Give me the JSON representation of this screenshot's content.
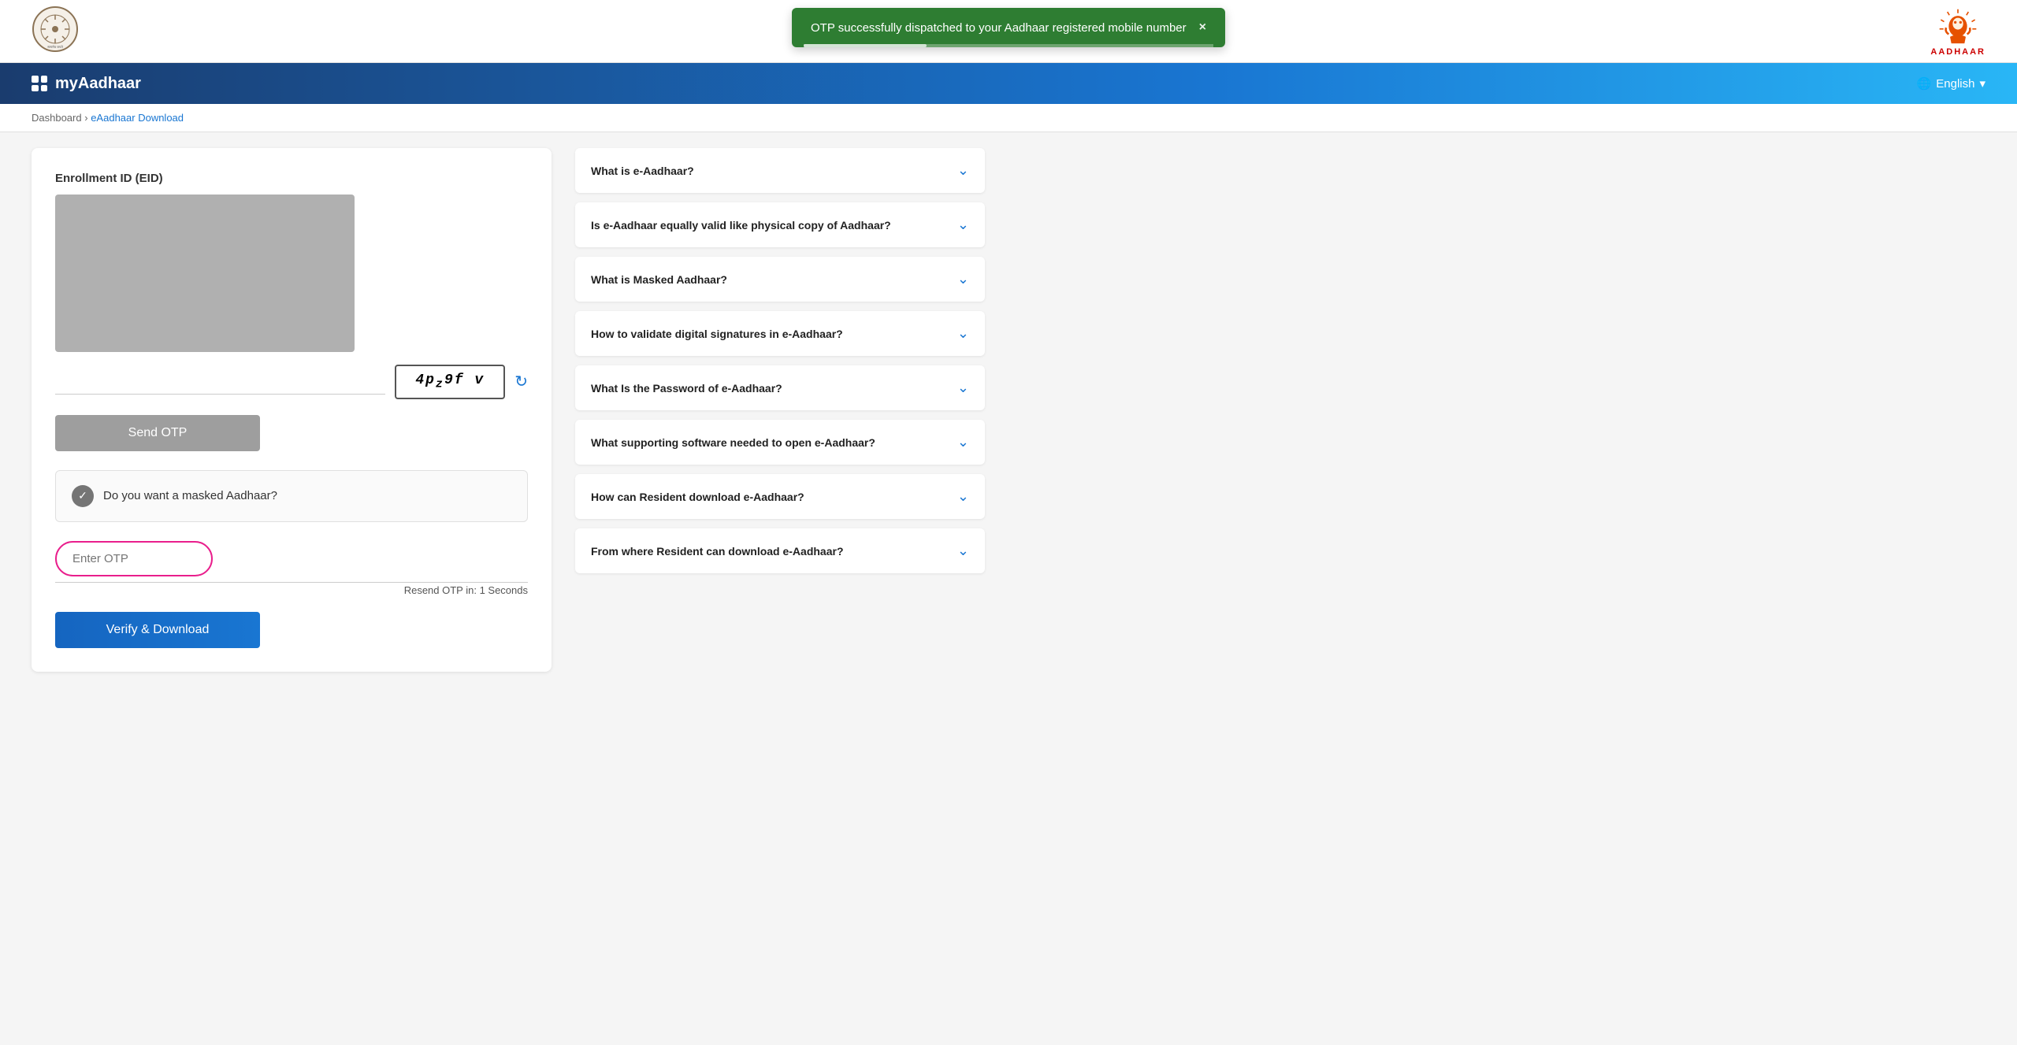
{
  "header": {
    "govt_logo_alt": "Government of India Logo",
    "aadhaar_logo_alt": "Aadhaar Logo",
    "aadhaar_text": "AADHAAR"
  },
  "notification": {
    "message": "OTP successfully dispatched to your Aadhaar registered mobile number",
    "close_label": "×"
  },
  "navbar": {
    "brand": "myAadhaar",
    "language_label": "English",
    "language_arrow": "▾"
  },
  "breadcrumb": {
    "home": "Dashboard",
    "separator": "›",
    "current": "eAadhaar Download"
  },
  "form": {
    "section_title": "Enrollment ID (EID)",
    "captcha_value": "4pz9fv",
    "captcha_display": "4p₂⁹f v",
    "send_otp_label": "Send OTP",
    "masked_label": "Do you want a masked Aadhaar?",
    "otp_placeholder": "Enter OTP",
    "resend_label": "Resend OTP in: 1 Seconds",
    "verify_label": "Verify & Download"
  },
  "faq": {
    "items": [
      {
        "id": 1,
        "question": "What is e-Aadhaar?",
        "expanded": false
      },
      {
        "id": 2,
        "question": "Is e-Aadhaar equally valid like physical copy of Aadhaar?",
        "expanded": false
      },
      {
        "id": 3,
        "question": "What is Masked Aadhaar?",
        "expanded": false
      },
      {
        "id": 4,
        "question": "How to validate digital signatures in e-Aadhaar?",
        "expanded": false
      },
      {
        "id": 5,
        "question": "What Is the Password of e-Aadhaar?",
        "expanded": false
      },
      {
        "id": 6,
        "question": "What supporting software needed to open e-Aadhaar?",
        "expanded": false
      },
      {
        "id": 7,
        "question": "How can Resident download e-Aadhaar?",
        "expanded": false
      },
      {
        "id": 8,
        "question": "From where Resident can download e-Aadhaar?",
        "expanded": false
      }
    ]
  }
}
